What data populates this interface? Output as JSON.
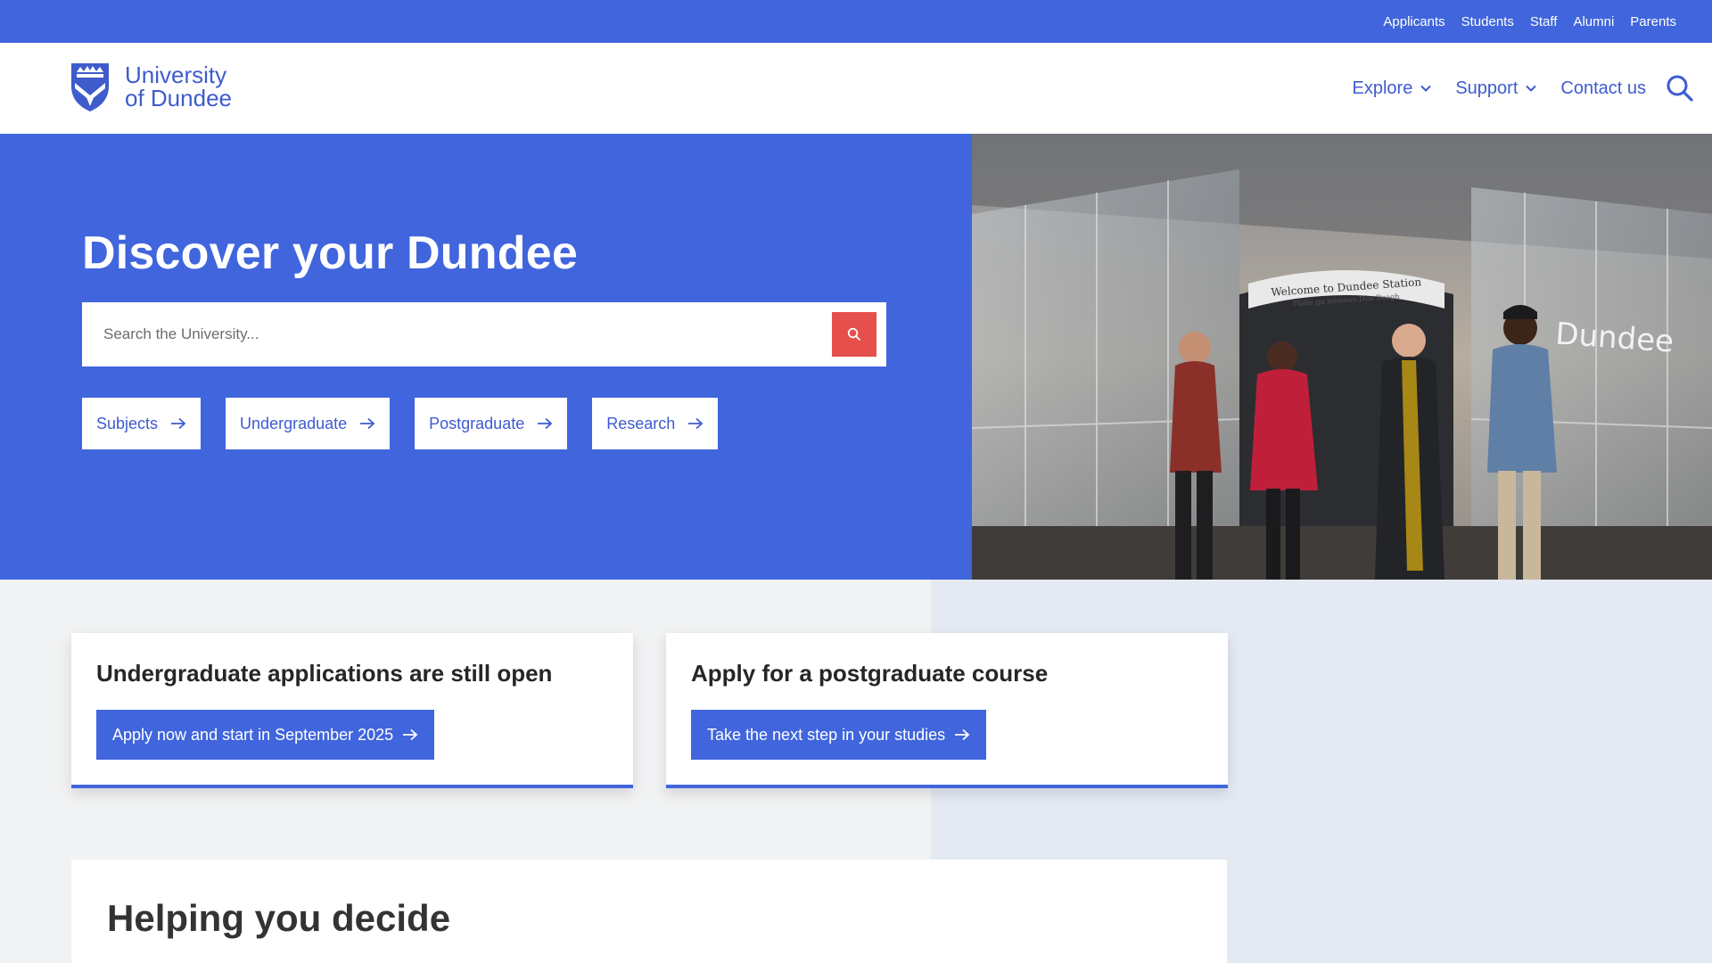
{
  "utility_nav": {
    "items": [
      "Applicants",
      "Students",
      "Staff",
      "Alumni",
      "Parents"
    ]
  },
  "header": {
    "logo_line1": "University",
    "logo_line2": "of Dundee",
    "nav": {
      "explore": "Explore",
      "support": "Support",
      "contact": "Contact us"
    },
    "search_icon": "search-icon"
  },
  "hero": {
    "title": "Discover your Dundee",
    "search": {
      "placeholder": "Search the University...",
      "value": ""
    },
    "quick_links": [
      "Subjects",
      "Undergraduate",
      "Postgraduate",
      "Research"
    ],
    "photo_sign_line1": "Welcome to Dundee Station",
    "photo_sign_line2": "Fàilte gu stèisean Dùn Deagh",
    "photo_wall_text": "Dundee"
  },
  "cards": [
    {
      "title": "Undergraduate applications are still open",
      "button": "Apply now and start in September 2025"
    },
    {
      "title": "Apply for a postgraduate course",
      "button": "Take the next step in your studies"
    }
  ],
  "decide": {
    "title": "Helping you decide"
  },
  "colors": {
    "brand_blue": "#4065dc",
    "link_blue": "#3e5bd1",
    "search_red": "#e6504c",
    "page_bg": "#f1f2f3",
    "panel_bg_right": "#e4e9f2"
  }
}
